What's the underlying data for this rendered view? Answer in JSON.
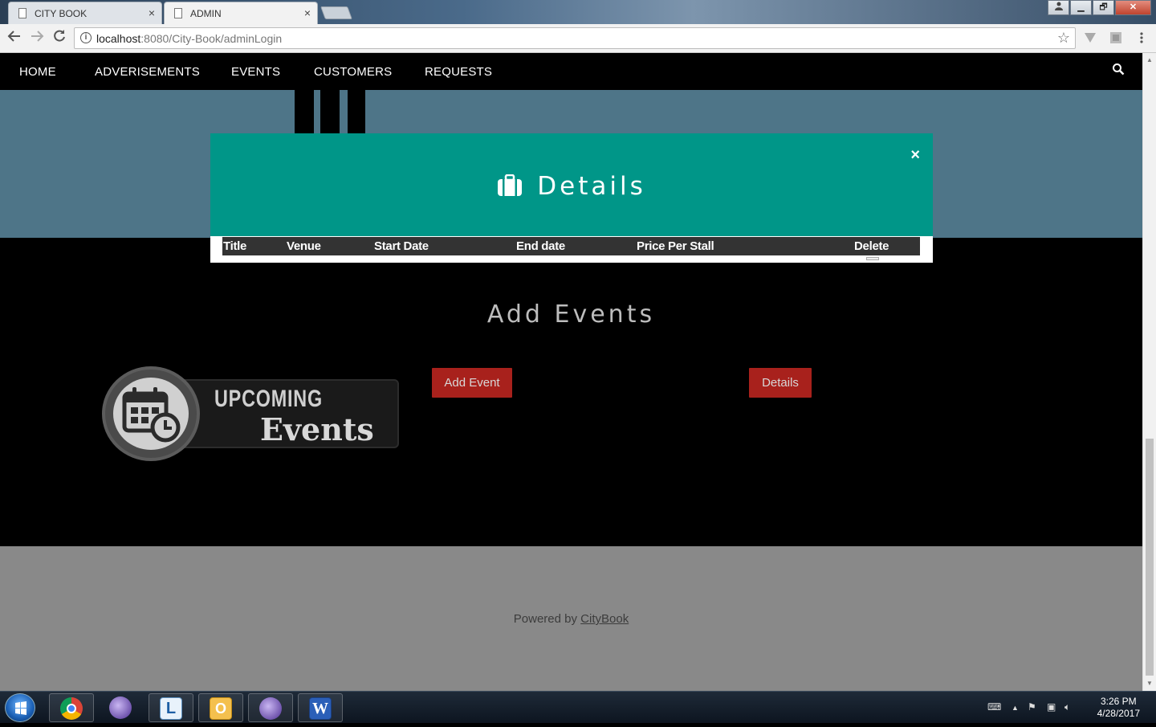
{
  "browser": {
    "tabs": [
      {
        "label": "CITY BOOK",
        "close": "×"
      },
      {
        "label": "ADMIN",
        "close": "×"
      }
    ],
    "url_host": "localhost",
    "url_rest": ":8080/City-Book/adminLogin",
    "window_buttons": [
      "▁",
      "🗗",
      "✕"
    ]
  },
  "nav": {
    "items": [
      "HOME",
      "ADVERISEMENTS",
      "EVENTS",
      "CUSTOMERS",
      "REQUESTS"
    ]
  },
  "modal": {
    "title": "Details",
    "close": "×",
    "columns": [
      "Title",
      "Venue",
      "Start Date",
      "End date",
      "Price Per Stall",
      "Delete"
    ]
  },
  "section": {
    "title": "Add Events",
    "banner_line1": "UPCOMING",
    "banner_line2": "Events",
    "add_button": "Add Event",
    "details_button": "Details"
  },
  "footer": {
    "prefix": "Powered by ",
    "link": "CityBook"
  },
  "taskbar": {
    "time": "3:26 PM",
    "date": "4/28/2017"
  },
  "colors": {
    "modal_header": "#009688",
    "button": "#a8211c",
    "hero": "#4e7588",
    "footer": "#898989"
  }
}
